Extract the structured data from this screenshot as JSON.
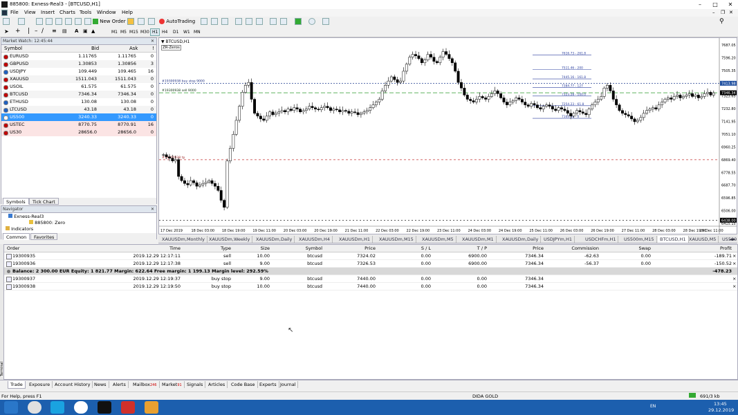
{
  "title": "885800: Exness-Real3 - [BTCUSD,H1]",
  "menu": [
    "File",
    "View",
    "Insert",
    "Charts",
    "Tools",
    "Window",
    "Help"
  ],
  "toolbar": {
    "new_order": "New Order",
    "autotrading": "AutoTrading"
  },
  "timeframes": [
    "M1",
    "M5",
    "M15",
    "M30",
    "H1",
    "H4",
    "D1",
    "W1",
    "MN"
  ],
  "active_tf": "H1",
  "market_watch": {
    "header": "Market Watch: 12:45:44",
    "columns": [
      "Symbol",
      "Bid",
      "Ask",
      "!"
    ],
    "rows": [
      {
        "symbol": "EURUSD",
        "bid": "1.11765",
        "ask": "1.11765",
        "spread": "0",
        "color": "#c00000"
      },
      {
        "symbol": "GBPUSD",
        "bid": "1.30853",
        "ask": "1.30856",
        "spread": "3",
        "color": "#c00000"
      },
      {
        "symbol": "USDJPY",
        "bid": "109.449",
        "ask": "109.465",
        "spread": "16",
        "color": "#2060c0"
      },
      {
        "symbol": "XAUUSD",
        "bid": "1511.043",
        "ask": "1511.043",
        "spread": "0",
        "color": "#c00000"
      },
      {
        "symbol": "USOIL",
        "bid": "61.575",
        "ask": "61.575",
        "spread": "0",
        "color": "#c00000"
      },
      {
        "symbol": "BTCUSD",
        "bid": "7346.34",
        "ask": "7346.34",
        "spread": "0",
        "color": "#c00000"
      },
      {
        "symbol": "ETHUSD",
        "bid": "130.08",
        "ask": "130.08",
        "spread": "0",
        "color": "#2060c0"
      },
      {
        "symbol": "LTCUSD",
        "bid": "43.18",
        "ask": "43.18",
        "spread": "0",
        "color": "#2060c0"
      },
      {
        "symbol": "US500",
        "bid": "3240.33",
        "ask": "3240.33",
        "spread": "0",
        "color": "#ffffff"
      },
      {
        "symbol": "USTEC",
        "bid": "8770.75",
        "ask": "8770.91",
        "spread": "16",
        "color": "#c00000"
      },
      {
        "symbol": "US30",
        "bid": "28656.0",
        "ask": "28656.0",
        "spread": "0",
        "color": "#c00000"
      }
    ],
    "tabs": [
      "Symbols",
      "Tick Chart"
    ]
  },
  "navigator": {
    "header": "Navigator",
    "account_group": "Exness-Real3",
    "account": "885800: Zero",
    "indicators": "Indicators",
    "tabs": [
      "Common",
      "Favorites"
    ]
  },
  "chart": {
    "label": "BTCUSD,H1",
    "sublabel": "ZR-Zeros",
    "price_axis": [
      "7687.05",
      "7596.20",
      "7505.35",
      "7414.50",
      "7323.65",
      "7232.80",
      "7141.95",
      "7051.10",
      "6960.25",
      "6869.40",
      "6778.55",
      "6687.70",
      "6596.85",
      "6506.00",
      "6415.15"
    ],
    "highlighted_prices": [
      {
        "value": "7413.98",
        "bg": "#2050a0",
        "fg": "#ffffff"
      },
      {
        "value": "7346.34",
        "bg": "#000000",
        "fg": "#ffffff"
      },
      {
        "value": "6438.00",
        "bg": "#000000",
        "fg": "#ffffff"
      }
    ],
    "time_axis": [
      "17 Dec 2019",
      "18 Dec 03:00",
      "18 Dec 19:00",
      "19 Dec 11:00",
      "20 Dec 03:00",
      "20 Dec 19:00",
      "21 Dec 11:00",
      "22 Dec 03:00",
      "22 Dec 19:00",
      "23 Dec 11:00",
      "24 Dec 03:00",
      "24 Dec 19:00",
      "25 Dec 11:00",
      "26 Dec 03:00",
      "26 Dec 19:00",
      "27 Dec 11:00",
      "28 Dec 03:00",
      "28 Dec 19:00",
      "29 Dec 11:00"
    ],
    "order_labels": [
      {
        "text": "#19300938 buy stop 9000",
        "color": "#203080"
      },
      {
        "text": "#19300938 sell 9000",
        "color": "#103010"
      },
      {
        "text": "#19300938 tp",
        "color": "#a03030"
      }
    ],
    "fib_labels": [
      "7616.73 - 261.8",
      "7511.46 - 200",
      "7445.16 - 161.8",
      "7384.77 - 127",
      "7323.28 - 100.0",
      "7254.23 - 61.8",
      "7164.38 - 0"
    ],
    "candles": [
      6905,
      6890,
      6880,
      6860,
      6870,
      6750,
      6720,
      6700,
      6690,
      6720,
      6705,
      6680,
      6690,
      6700,
      6710,
      6720,
      6700,
      6680,
      6650,
      6580,
      6530,
      6860,
      6950,
      7050,
      7150,
      7250,
      7350,
      7400,
      7420,
      7300,
      7200,
      7180,
      7160,
      7150,
      7180,
      7210,
      7190,
      7200,
      7210,
      7220,
      7210,
      7230,
      7220,
      7240,
      7230,
      7210,
      7220,
      7230,
      7250,
      7240,
      7230,
      7225,
      7240,
      7250,
      7240,
      7220,
      7230,
      7225,
      7210,
      7220,
      7215,
      7200,
      7210,
      7205,
      7190,
      7200,
      7210,
      7220,
      7240,
      7260,
      7280,
      7300,
      7360,
      7400,
      7430,
      7460,
      7440,
      7420,
      7430,
      7500,
      7550,
      7600,
      7620,
      7610,
      7590,
      7560,
      7580,
      7620,
      7600,
      7570,
      7560,
      7600,
      7640,
      7620,
      7590,
      7560,
      7500,
      7420,
      7380,
      7330,
      7300,
      7290,
      7280,
      7300,
      7320,
      7310,
      7300,
      7320,
      7340,
      7360,
      7340,
      7310,
      7280,
      7260,
      7280,
      7290,
      7310,
      7300,
      7280,
      7260,
      7250,
      7270,
      7260,
      7240,
      7230,
      7250,
      7260,
      7250,
      7230,
      7220,
      7240,
      7230,
      7220,
      7200,
      7180,
      7200,
      7220,
      7210,
      7200,
      7190,
      7230,
      7260,
      7280,
      7300,
      7320,
      7380,
      7400,
      7360,
      7300,
      7260,
      7220,
      7200,
      7190,
      7180,
      7160,
      7140,
      7150,
      7170,
      7200,
      7220,
      7230,
      7240,
      7230,
      7260,
      7280,
      7300,
      7310,
      7300,
      7320,
      7330,
      7310,
      7320,
      7330,
      7340,
      7320,
      7330,
      7310,
      7320,
      7340,
      7350,
      7330,
      7346
    ]
  },
  "chart_tabs": [
    "XAUUSDm,Monthly",
    "XAUUSDm,Weekly",
    "XAUUSDm,Daily",
    "XAUUSDm,H4",
    "XAUUSDm,H1",
    "XAUUSDm,M15",
    "XAUUSDm,M5",
    "XAUUSDm,M1",
    "XAUUSDm,Daily",
    "USDJPYm,H1",
    "USDCHFm,H1",
    "US500m,M15",
    "BTCUSD,H1",
    "XAUUSD,M5",
    "US500"
  ],
  "active_chart_tab": "BTCUSD,H1",
  "orders": {
    "columns": [
      "Order",
      "Time",
      "Type",
      "Size",
      "Symbol",
      "Price",
      "S / L",
      "T / P",
      "Price",
      "Commission",
      "Swap",
      "Profit"
    ],
    "rows": [
      {
        "order": "19300935",
        "time": "2019.12.29 12:17:11",
        "type": "sell",
        "size": "10.00",
        "symbol": "btcusd",
        "price": "7324.02",
        "sl": "0.00",
        "tp": "6900.00",
        "cur": "7346.34",
        "commission": "-62.63",
        "swap": "0.00",
        "profit": "-189.71"
      },
      {
        "order": "19300936",
        "time": "2019.12.29 12:17:38",
        "type": "sell",
        "size": "9.00",
        "symbol": "btcusd",
        "price": "7326.53",
        "sl": "0.00",
        "tp": "6900.00",
        "cur": "7346.34",
        "commission": "-56.37",
        "swap": "0.00",
        "profit": "-150.52"
      }
    ],
    "balance_text": "Balance: 2 300.00 EUR  Equity: 1 821.77  Margin: 622.64  Free margin: 1 199.13  Margin level: 292.59%",
    "balance_profit": "-478.23",
    "pending": [
      {
        "order": "19300937",
        "time": "2019.12.29 12:19:37",
        "type": "buy stop",
        "size": "9.00",
        "symbol": "btcusd",
        "price": "7440.00",
        "sl": "0.00",
        "tp": "0.00",
        "cur": "7346.34"
      },
      {
        "order": "19300938",
        "time": "2019.12.29 12:19:50",
        "type": "buy stop",
        "size": "10.00",
        "symbol": "btcusd",
        "price": "7440.00",
        "sl": "0.00",
        "tp": "0.00",
        "cur": "7346.34"
      }
    ]
  },
  "bottom_tabs": [
    {
      "label": "Trade",
      "badge": ""
    },
    {
      "label": "Exposure",
      "badge": ""
    },
    {
      "label": "Account History",
      "badge": ""
    },
    {
      "label": "News",
      "badge": ""
    },
    {
      "label": "Alerts",
      "badge": ""
    },
    {
      "label": "Mailbox",
      "badge": "246"
    },
    {
      "label": "Market",
      "badge": "91"
    },
    {
      "label": "Signals",
      "badge": ""
    },
    {
      "label": "Articles",
      "badge": ""
    },
    {
      "label": "Code Base",
      "badge": ""
    },
    {
      "label": "Experts",
      "badge": ""
    },
    {
      "label": "Journal",
      "badge": ""
    }
  ],
  "terminal_side": "Terminal",
  "status": {
    "help": "For Help, press F1",
    "profile": "DIDA GOLD",
    "traffic": "691/3 kb"
  },
  "taskbar": {
    "lang": "EN",
    "time": "13:45",
    "date": "29.12.2019"
  }
}
